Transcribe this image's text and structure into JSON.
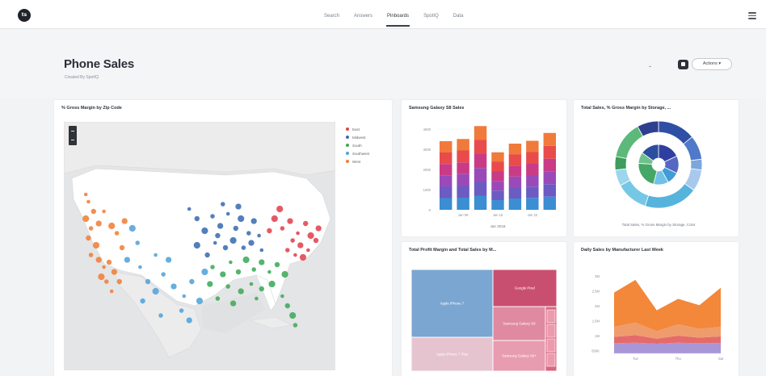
{
  "app": {
    "logo_text": "ts"
  },
  "nav": {
    "items": [
      "Search",
      "Answers",
      "Pinboards",
      "SpotIQ",
      "Data"
    ],
    "active_index": 2
  },
  "header": {
    "title": "Phone Sales",
    "subtitle": "Created By SpotIQ",
    "dash": "-",
    "actions_label": "Actions ▾"
  },
  "cards": {
    "map": {
      "title": "% Gross Margin by Zip Code",
      "legend": [
        {
          "label": "East",
          "color": "#e2424e"
        },
        {
          "label": "Midwest",
          "color": "#3b6db3"
        },
        {
          "label": "South",
          "color": "#3faa5a"
        },
        {
          "label": "Southwest",
          "color": "#52a3db"
        },
        {
          "label": "West",
          "color": "#f08038"
        }
      ],
      "dots": [
        {
          "lon": 0.07,
          "lat": 0.33,
          "region": "West"
        },
        {
          "lon": 0.09,
          "lat": 0.37,
          "region": "West"
        },
        {
          "lon": 0.06,
          "lat": 0.4,
          "region": "West"
        },
        {
          "lon": 0.08,
          "lat": 0.44,
          "region": "West"
        },
        {
          "lon": 0.11,
          "lat": 0.42,
          "region": "West"
        },
        {
          "lon": 0.13,
          "lat": 0.37,
          "region": "West"
        },
        {
          "lon": 0.07,
          "lat": 0.48,
          "region": "West"
        },
        {
          "lon": 0.1,
          "lat": 0.51,
          "region": "West"
        },
        {
          "lon": 0.08,
          "lat": 0.55,
          "region": "West"
        },
        {
          "lon": 0.11,
          "lat": 0.57,
          "region": "West"
        },
        {
          "lon": 0.13,
          "lat": 0.6,
          "region": "West"
        },
        {
          "lon": 0.15,
          "lat": 0.58,
          "region": "West"
        },
        {
          "lon": 0.12,
          "lat": 0.64,
          "region": "West"
        },
        {
          "lon": 0.14,
          "lat": 0.66,
          "region": "West"
        },
        {
          "lon": 0.17,
          "lat": 0.62,
          "region": "West"
        },
        {
          "lon": 0.16,
          "lat": 0.7,
          "region": "West"
        },
        {
          "lon": 0.19,
          "lat": 0.66,
          "region": "West"
        },
        {
          "lon": 0.16,
          "lat": 0.43,
          "region": "West"
        },
        {
          "lon": 0.18,
          "lat": 0.46,
          "region": "West"
        },
        {
          "lon": 0.21,
          "lat": 0.41,
          "region": "West"
        },
        {
          "lon": 0.06,
          "lat": 0.3,
          "region": "West"
        },
        {
          "lon": 0.2,
          "lat": 0.52,
          "region": "West"
        },
        {
          "lon": 0.24,
          "lat": 0.44,
          "region": "Southwest"
        },
        {
          "lon": 0.26,
          "lat": 0.5,
          "region": "Southwest"
        },
        {
          "lon": 0.22,
          "lat": 0.57,
          "region": "Southwest"
        },
        {
          "lon": 0.27,
          "lat": 0.6,
          "region": "Southwest"
        },
        {
          "lon": 0.3,
          "lat": 0.66,
          "region": "Southwest"
        },
        {
          "lon": 0.33,
          "lat": 0.7,
          "region": "Southwest"
        },
        {
          "lon": 0.36,
          "lat": 0.63,
          "region": "Southwest"
        },
        {
          "lon": 0.4,
          "lat": 0.68,
          "region": "Southwest"
        },
        {
          "lon": 0.44,
          "lat": 0.72,
          "region": "Southwest"
        },
        {
          "lon": 0.47,
          "lat": 0.66,
          "region": "Southwest"
        },
        {
          "lon": 0.5,
          "lat": 0.74,
          "region": "Southwest"
        },
        {
          "lon": 0.43,
          "lat": 0.78,
          "region": "Southwest"
        },
        {
          "lon": 0.38,
          "lat": 0.57,
          "region": "Southwest"
        },
        {
          "lon": 0.33,
          "lat": 0.55,
          "region": "Southwest"
        },
        {
          "lon": 0.28,
          "lat": 0.74,
          "region": "Southwest"
        },
        {
          "lon": 0.52,
          "lat": 0.62,
          "region": "Southwest"
        },
        {
          "lon": 0.35,
          "lat": 0.8,
          "region": "Southwest"
        },
        {
          "lon": 0.46,
          "lat": 0.82,
          "region": "Southwest"
        },
        {
          "lon": 0.46,
          "lat": 0.36,
          "region": "Midwest"
        },
        {
          "lon": 0.49,
          "lat": 0.4,
          "region": "Midwest"
        },
        {
          "lon": 0.52,
          "lat": 0.45,
          "region": "Midwest"
        },
        {
          "lon": 0.55,
          "lat": 0.39,
          "region": "Midwest"
        },
        {
          "lon": 0.58,
          "lat": 0.43,
          "region": "Midwest"
        },
        {
          "lon": 0.61,
          "lat": 0.38,
          "region": "Midwest"
        },
        {
          "lon": 0.64,
          "lat": 0.44,
          "region": "Midwest"
        },
        {
          "lon": 0.66,
          "lat": 0.4,
          "region": "Midwest"
        },
        {
          "lon": 0.69,
          "lat": 0.46,
          "region": "Midwest"
        },
        {
          "lon": 0.71,
          "lat": 0.41,
          "region": "Midwest"
        },
        {
          "lon": 0.56,
          "lat": 0.5,
          "region": "Midwest"
        },
        {
          "lon": 0.6,
          "lat": 0.52,
          "region": "Midwest"
        },
        {
          "lon": 0.63,
          "lat": 0.49,
          "region": "Midwest"
        },
        {
          "lon": 0.67,
          "lat": 0.52,
          "region": "Midwest"
        },
        {
          "lon": 0.7,
          "lat": 0.5,
          "region": "Midwest"
        },
        {
          "lon": 0.73,
          "lat": 0.47,
          "region": "Midwest"
        },
        {
          "lon": 0.53,
          "lat": 0.55,
          "region": "Midwest"
        },
        {
          "lon": 0.49,
          "lat": 0.51,
          "region": "Midwest"
        },
        {
          "lon": 0.59,
          "lat": 0.34,
          "region": "Midwest"
        },
        {
          "lon": 0.65,
          "lat": 0.35,
          "region": "Midwest"
        },
        {
          "lon": 0.74,
          "lat": 0.53,
          "region": "Midwest"
        },
        {
          "lon": 0.57,
          "lat": 0.47,
          "region": "Midwest"
        },
        {
          "lon": 0.79,
          "lat": 0.4,
          "region": "East"
        },
        {
          "lon": 0.82,
          "lat": 0.44,
          "region": "East"
        },
        {
          "lon": 0.85,
          "lat": 0.41,
          "region": "East"
        },
        {
          "lon": 0.88,
          "lat": 0.46,
          "region": "East"
        },
        {
          "lon": 0.91,
          "lat": 0.42,
          "region": "East"
        },
        {
          "lon": 0.93,
          "lat": 0.47,
          "region": "East"
        },
        {
          "lon": 0.86,
          "lat": 0.49,
          "region": "East"
        },
        {
          "lon": 0.89,
          "lat": 0.51,
          "region": "East"
        },
        {
          "lon": 0.92,
          "lat": 0.53,
          "region": "East"
        },
        {
          "lon": 0.95,
          "lat": 0.49,
          "region": "East"
        },
        {
          "lon": 0.81,
          "lat": 0.36,
          "region": "East"
        },
        {
          "lon": 0.84,
          "lat": 0.53,
          "region": "East"
        },
        {
          "lon": 0.96,
          "lat": 0.44,
          "region": "East"
        },
        {
          "lon": 0.87,
          "lat": 0.55,
          "region": "East"
        },
        {
          "lon": 0.77,
          "lat": 0.45,
          "region": "East"
        },
        {
          "lon": 0.9,
          "lat": 0.56,
          "region": "East"
        },
        {
          "lon": 0.55,
          "lat": 0.6,
          "region": "South"
        },
        {
          "lon": 0.59,
          "lat": 0.63,
          "region": "South"
        },
        {
          "lon": 0.62,
          "lat": 0.58,
          "region": "South"
        },
        {
          "lon": 0.65,
          "lat": 0.62,
          "region": "South"
        },
        {
          "lon": 0.68,
          "lat": 0.57,
          "region": "South"
        },
        {
          "lon": 0.71,
          "lat": 0.61,
          "region": "South"
        },
        {
          "lon": 0.74,
          "lat": 0.58,
          "region": "South"
        },
        {
          "lon": 0.77,
          "lat": 0.62,
          "region": "South"
        },
        {
          "lon": 0.8,
          "lat": 0.59,
          "region": "South"
        },
        {
          "lon": 0.83,
          "lat": 0.63,
          "region": "South"
        },
        {
          "lon": 0.61,
          "lat": 0.68,
          "region": "South"
        },
        {
          "lon": 0.66,
          "lat": 0.7,
          "region": "South"
        },
        {
          "lon": 0.7,
          "lat": 0.67,
          "region": "South"
        },
        {
          "lon": 0.74,
          "lat": 0.69,
          "region": "South"
        },
        {
          "lon": 0.78,
          "lat": 0.67,
          "region": "South"
        },
        {
          "lon": 0.57,
          "lat": 0.73,
          "region": "South"
        },
        {
          "lon": 0.54,
          "lat": 0.67,
          "region": "South"
        },
        {
          "lon": 0.82,
          "lat": 0.72,
          "region": "South"
        },
        {
          "lon": 0.84,
          "lat": 0.76,
          "region": "South"
        },
        {
          "lon": 0.86,
          "lat": 0.8,
          "region": "South"
        },
        {
          "lon": 0.87,
          "lat": 0.84,
          "region": "South"
        },
        {
          "lon": 0.63,
          "lat": 0.75,
          "region": "South"
        },
        {
          "lon": 0.72,
          "lat": 0.73,
          "region": "South"
        }
      ]
    },
    "samsung": {
      "title": "Samsung Galaxy S8 Sales",
      "xlabel": "Jan 2018",
      "legend_none": ""
    },
    "storage": {
      "title": "Total Sales, % Gross Margin by Storage, ...",
      "caption": "Total Sales, % Gross Margin by Storage, Color"
    },
    "profit": {
      "title": "Total Profit Margin and Total Sales by M..."
    },
    "daily": {
      "title": "Daily Sales by Manufacturer Last Week"
    }
  },
  "chart_data": [
    {
      "type": "bar",
      "title": "Samsung Galaxy S8 Sales",
      "xlabel": "Jan 2018",
      "categories": [
        "",
        "Jan 08",
        "",
        "Jan 15",
        "",
        "Jan 22",
        ""
      ],
      "tick_labels_y": [
        "4000",
        "3000",
        "2000",
        "1000",
        "0"
      ],
      "ylim": [
        0,
        4000
      ],
      "colors": [
        "#3a8ed1",
        "#6c5bc2",
        "#9a4ab8",
        "#c93b86",
        "#e94b4b",
        "#f07a3b"
      ],
      "series": [
        {
          "values": [
            580,
            600,
            700,
            480,
            560,
            590,
            650
          ]
        },
        {
          "values": [
            560,
            580,
            680,
            470,
            540,
            560,
            620
          ]
        },
        {
          "values": [
            570,
            590,
            690,
            480,
            550,
            570,
            640
          ]
        },
        {
          "values": [
            560,
            580,
            690,
            470,
            540,
            560,
            620
          ]
        },
        {
          "values": [
            570,
            590,
            700,
            480,
            550,
            580,
            640
          ]
        },
        {
          "values": [
            560,
            570,
            690,
            470,
            540,
            560,
            640
          ]
        }
      ]
    },
    {
      "type": "pie",
      "title": "Total Sales, % Gross Margin by Storage, ...",
      "rings": [
        {
          "name": "outer",
          "values": [
            14,
            9,
            4,
            8,
            20,
            12,
            6,
            5,
            14,
            8
          ],
          "colors": [
            "#2e4fa3",
            "#4f79c9",
            "#7da6dd",
            "#a9c9ec",
            "#56b4dc",
            "#76c7e6",
            "#9bd6ec",
            "#3e9c5d",
            "#5cb97a",
            "#2f3f8f"
          ]
        },
        {
          "name": "inner",
          "values": [
            18,
            14,
            10,
            12,
            22,
            9,
            15
          ],
          "colors": [
            "#2f3fa0",
            "#5567c2",
            "#3e9cd6",
            "#71c0e6",
            "#45a767",
            "#6fc18c",
            "#2c4e9e"
          ]
        }
      ]
    },
    {
      "type": "heatmap",
      "title": "Total Profit Margin and Total Sales by M...",
      "tiles": [
        {
          "label": "Apple iPhone 7",
          "value": 46,
          "color": "#7ba6d2"
        },
        {
          "label": "Apple iPhone 7 Plus",
          "value": 17,
          "color": "#e5c4cf"
        },
        {
          "label": "Google Pixel",
          "value": 12,
          "color": "#c94f70"
        },
        {
          "label": "Samsung Galaxy S8",
          "value": 11,
          "color": "#df8aa0"
        },
        {
          "label": "Samsung Galaxy S8+",
          "value": 8,
          "color": "#e79cb0"
        },
        {
          "label": "",
          "value": 6,
          "color": "#d9667f"
        }
      ]
    },
    {
      "type": "area",
      "title": "Daily Sales by Manufacturer Last Week",
      "categories": [
        "Mon",
        "Tue",
        "Wed",
        "Thu",
        "Fri",
        "Sat"
      ],
      "tick_labels_y": [
        "3M",
        "2.5M",
        "2M",
        "1.5M",
        "1M",
        "500K"
      ],
      "ylim": [
        0,
        3500000
      ],
      "series": [
        {
          "color": "#a996d6",
          "values": [
            400000,
            420000,
            380000,
            420000,
            400000,
            410000
          ]
        },
        {
          "color": "#e56b6b",
          "values": [
            250000,
            300000,
            200000,
            280000,
            220000,
            260000
          ]
        },
        {
          "color": "#ef9c6c",
          "values": [
            400000,
            500000,
            300000,
            450000,
            350000,
            380000
          ]
        },
        {
          "color": "#f3873a",
          "values": [
            1350000,
            1680000,
            820000,
            1000000,
            930000,
            1540000
          ]
        }
      ]
    }
  ]
}
